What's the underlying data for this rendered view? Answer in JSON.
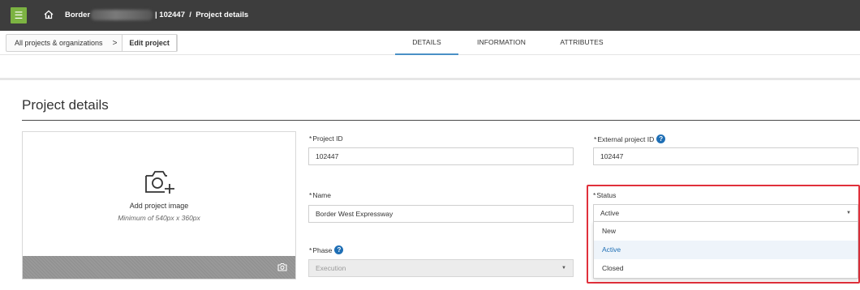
{
  "topbar": {
    "menu_icon": "hamburger-icon",
    "home_icon": "home-icon",
    "breadcrumb_start": "Border",
    "breadcrumb_rest": "| 102447  /  Project details",
    "background_color": "#3d3d3d",
    "menu_color": "#7cb342"
  },
  "nav": {
    "all_projects": "All projects & organizations",
    "separator": ">",
    "current": "Edit project",
    "tabs": [
      {
        "label": "DETAILS",
        "active": true
      },
      {
        "label": "INFORMATION",
        "active": false
      },
      {
        "label": "ATTRIBUTES",
        "active": false
      }
    ],
    "active_tab_color": "#4a90c6"
  },
  "page": {
    "title": "Project details"
  },
  "image_panel": {
    "add_label": "Add project image",
    "min_size": "Minimum of 540px x 360px",
    "camera_icon": "camera-add-icon",
    "footer_icon": "camera-icon"
  },
  "form": {
    "project_id": {
      "label": "Project ID",
      "value": "102447",
      "required": "*"
    },
    "external_id": {
      "label": "External project ID",
      "value": "102447",
      "required": "*"
    },
    "name": {
      "label": "Name",
      "value": "Border West Expressway",
      "required": "*"
    },
    "status": {
      "label": "Status",
      "value": "Active",
      "required": "*",
      "highlight_color": "#e0303b"
    },
    "phase": {
      "label": "Phase",
      "value": "Execution",
      "required": "*",
      "disabled": true
    }
  },
  "status_options": [
    "New",
    "Active",
    "Closed"
  ],
  "status_selected": "Active",
  "colors": {
    "accent": "#1f6fb5",
    "selected_option_bg": "#eef4fa"
  }
}
